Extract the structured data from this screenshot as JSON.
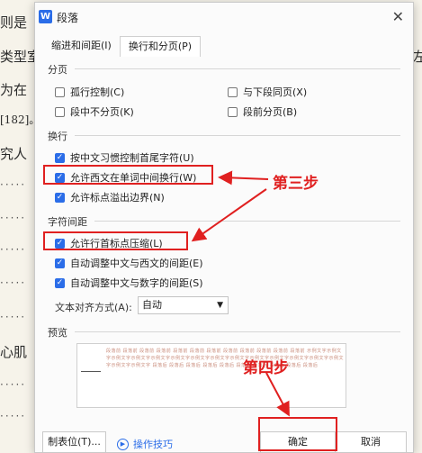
{
  "background": {
    "lines": [
      "则是",
      "类型室",
      "为在",
      "[182]。",
      "究人",
      "心肌"
    ],
    "right_glyphs": [
      "《",
      "左"
    ]
  },
  "dialog": {
    "title": "段落",
    "close": "✕",
    "app_icon": "W",
    "tabs": [
      "缩进和间距(I)",
      "换行和分页(P)"
    ],
    "active_tab": 1,
    "sections": {
      "pagination": {
        "label": "分页",
        "options": [
          {
            "label": "孤行控制(C)",
            "checked": false
          },
          {
            "label": "与下段同页(X)",
            "checked": false
          },
          {
            "label": "段中不分页(K)",
            "checked": false
          },
          {
            "label": "段前分页(B)",
            "checked": false
          }
        ]
      },
      "line_break": {
        "label": "换行",
        "options": [
          {
            "label": "按中文习惯控制首尾字符(U)",
            "checked": true
          },
          {
            "label": "允许西文在单词中间换行(W)",
            "checked": true
          },
          {
            "label": "允许标点溢出边界(N)",
            "checked": true
          }
        ]
      },
      "char_spacing": {
        "label": "字符间距",
        "options": [
          {
            "label": "允许行首标点压缩(L)",
            "checked": true
          },
          {
            "label": "自动调整中文与西文的间距(E)",
            "checked": true
          },
          {
            "label": "自动调整中文与数字的间距(S)",
            "checked": true
          }
        ]
      },
      "alignment": {
        "label": "文本对齐方式(A):",
        "value": "自动"
      },
      "preview": {
        "label": "预览",
        "text": "段落前 段落前 段落前 段落前 段落前 段落前 段落前 段落前 段落前 段落前 段落前 段落前 示例文字示例文字示例文字示例文字示例文字示例文字示例文字示例文字示例文字示例文字示例文字示例文字示例文字示例文字示例文字示例文字 段落后 段落后 段落后 段落后 段落后 段落后 段落后 段落后 段落后 段落后"
      }
    },
    "buttons": {
      "tabs": "制表位(T)...",
      "tips": "操作技巧",
      "ok": "确定",
      "cancel": "取消"
    }
  },
  "annotations": {
    "step3": "第三步",
    "step4": "第四步",
    "color": "#e02020"
  },
  "colors": {
    "accent": "#2b6de8"
  }
}
